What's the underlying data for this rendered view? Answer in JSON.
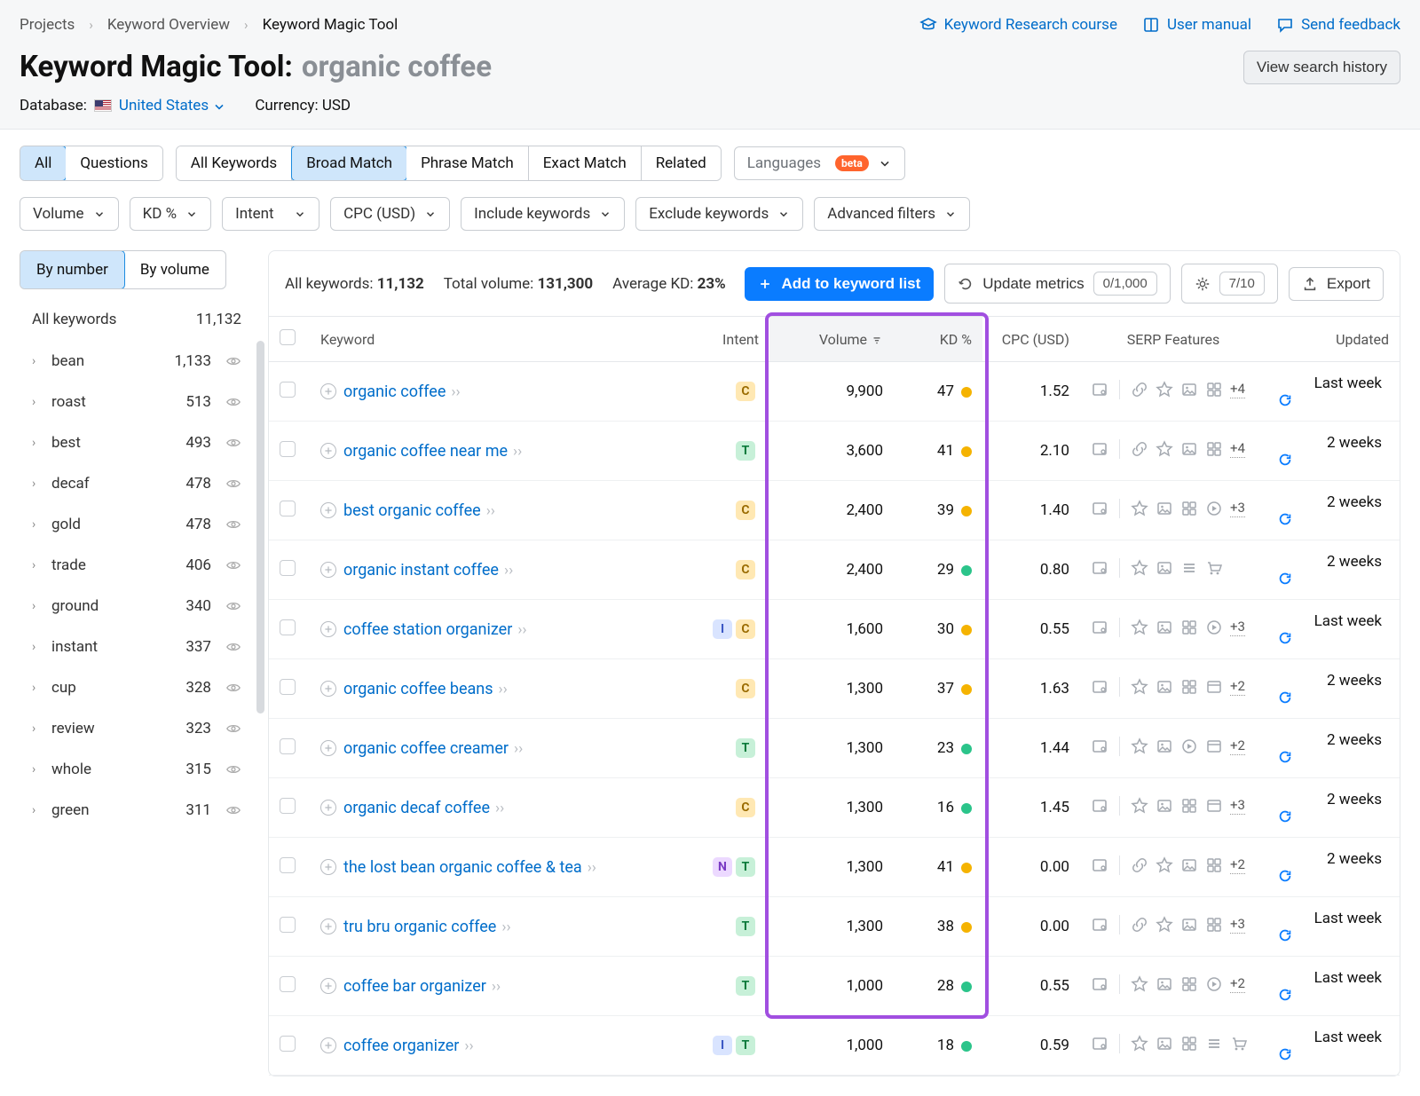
{
  "breadcrumbs": [
    "Projects",
    "Keyword Overview",
    "Keyword Magic Tool"
  ],
  "help_links": {
    "course": "Keyword Research course",
    "manual": "User manual",
    "feedback": "Send feedback"
  },
  "page_title": "Keyword Magic Tool:",
  "page_keyword": "organic coffee",
  "view_history_btn": "View search history",
  "database_label": "Database:",
  "database_value": "United States",
  "currency_label": "Currency:",
  "currency_value": "USD",
  "tabs_left": {
    "all": "All",
    "questions": "Questions"
  },
  "tabs_match": {
    "all_kw": "All Keywords",
    "broad": "Broad Match",
    "phrase": "Phrase Match",
    "exact": "Exact Match",
    "related": "Related"
  },
  "languages_label": "Languages",
  "beta_label": "beta",
  "filters": {
    "volume": "Volume",
    "kd": "KD %",
    "intent": "Intent",
    "cpc": "CPC (USD)",
    "include": "Include keywords",
    "exclude": "Exclude keywords",
    "advanced": "Advanced filters"
  },
  "sidebar": {
    "by_number": "By number",
    "by_volume": "By volume",
    "all_label": "All keywords",
    "all_count": "11,132",
    "items": [
      {
        "label": "bean",
        "count": "1,133"
      },
      {
        "label": "roast",
        "count": "513"
      },
      {
        "label": "best",
        "count": "493"
      },
      {
        "label": "decaf",
        "count": "478"
      },
      {
        "label": "gold",
        "count": "478"
      },
      {
        "label": "trade",
        "count": "406"
      },
      {
        "label": "ground",
        "count": "340"
      },
      {
        "label": "instant",
        "count": "337"
      },
      {
        "label": "cup",
        "count": "328"
      },
      {
        "label": "review",
        "count": "323"
      },
      {
        "label": "whole",
        "count": "315"
      },
      {
        "label": "green",
        "count": "311"
      }
    ]
  },
  "summary": {
    "all_kw_label": "All keywords:",
    "all_kw": "11,132",
    "total_vol_label": "Total volume:",
    "total_vol": "131,300",
    "avg_kd_label": "Average KD:",
    "avg_kd": "23%"
  },
  "actions": {
    "add": "Add to keyword list",
    "update": "Update metrics",
    "update_count": "0/1,000",
    "gear_count": "7/10",
    "export": "Export"
  },
  "columns": {
    "keyword": "Keyword",
    "intent": "Intent",
    "volume": "Volume",
    "kd": "KD %",
    "cpc": "CPC (USD)",
    "serp": "SERP Features",
    "updated": "Updated"
  },
  "rows": [
    {
      "kw": "organic coffee",
      "intents": [
        "C"
      ],
      "vol": "9,900",
      "kd": "47",
      "kdcolor": "y",
      "cpc": "1.52",
      "serp": [
        "link",
        "star",
        "image",
        "imggrid"
      ],
      "more": "+4",
      "updated": "Last week"
    },
    {
      "kw": "organic coffee near me",
      "intents": [
        "T"
      ],
      "vol": "3,600",
      "kd": "41",
      "kdcolor": "y",
      "cpc": "2.10",
      "serp": [
        "link",
        "star",
        "image",
        "imggrid"
      ],
      "more": "+4",
      "updated": "2 weeks"
    },
    {
      "kw": "best organic coffee",
      "intents": [
        "C"
      ],
      "vol": "2,400",
      "kd": "39",
      "kdcolor": "y",
      "cpc": "1.40",
      "serp": [
        "star",
        "image",
        "imggrid",
        "play"
      ],
      "more": "+3",
      "updated": "2 weeks"
    },
    {
      "kw": "organic instant coffee",
      "intents": [
        "C"
      ],
      "vol": "2,400",
      "kd": "29",
      "kdcolor": "g",
      "cpc": "0.80",
      "serp": [
        "star",
        "image",
        "list",
        "cart"
      ],
      "more": "",
      "updated": "2 weeks"
    },
    {
      "kw": "coffee station organizer",
      "intents": [
        "I",
        "C"
      ],
      "vol": "1,600",
      "kd": "30",
      "kdcolor": "y",
      "cpc": "0.55",
      "serp": [
        "star",
        "image",
        "imggrid",
        "play"
      ],
      "more": "+3",
      "updated": "Last week"
    },
    {
      "kw": "organic coffee beans",
      "intents": [
        "C"
      ],
      "vol": "1,300",
      "kd": "37",
      "kdcolor": "y",
      "cpc": "1.63",
      "serp": [
        "star",
        "image",
        "imggrid",
        "panel"
      ],
      "more": "+2",
      "updated": "2 weeks"
    },
    {
      "kw": "organic coffee creamer",
      "intents": [
        "T"
      ],
      "vol": "1,300",
      "kd": "23",
      "kdcolor": "g",
      "cpc": "1.44",
      "serp": [
        "star",
        "image",
        "play",
        "panel"
      ],
      "more": "+2",
      "updated": "2 weeks"
    },
    {
      "kw": "organic decaf coffee",
      "intents": [
        "C"
      ],
      "vol": "1,300",
      "kd": "16",
      "kdcolor": "g",
      "cpc": "1.45",
      "serp": [
        "star",
        "image",
        "imggrid",
        "panel"
      ],
      "more": "+3",
      "updated": "2 weeks"
    },
    {
      "kw": "the lost bean organic coffee & tea",
      "intents": [
        "N",
        "T"
      ],
      "vol": "1,300",
      "kd": "41",
      "kdcolor": "y",
      "cpc": "0.00",
      "serp": [
        "link",
        "star",
        "image",
        "imggrid"
      ],
      "more": "+2",
      "updated": "2 weeks"
    },
    {
      "kw": "tru bru organic coffee",
      "intents": [
        "T"
      ],
      "vol": "1,300",
      "kd": "38",
      "kdcolor": "y",
      "cpc": "0.00",
      "serp": [
        "link",
        "star",
        "image",
        "imggrid"
      ],
      "more": "+3",
      "updated": "Last week"
    },
    {
      "kw": "coffee bar organizer",
      "intents": [
        "T"
      ],
      "vol": "1,000",
      "kd": "28",
      "kdcolor": "g",
      "cpc": "0.55",
      "serp": [
        "star",
        "image",
        "imggrid",
        "play"
      ],
      "more": "+2",
      "updated": "Last week"
    },
    {
      "kw": "coffee organizer",
      "intents": [
        "I",
        "T"
      ],
      "vol": "1,000",
      "kd": "18",
      "kdcolor": "g",
      "cpc": "0.59",
      "serp": [
        "star",
        "image",
        "imggrid",
        "list",
        "cart"
      ],
      "more": "",
      "updated": "Last week"
    }
  ]
}
